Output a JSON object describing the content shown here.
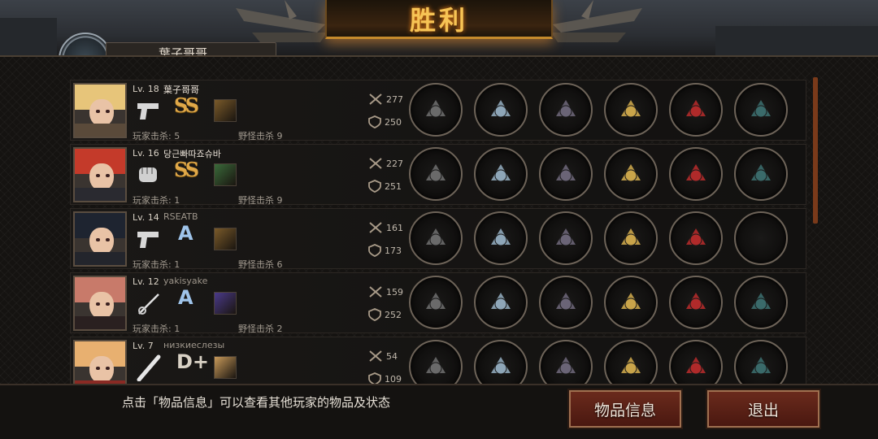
{
  "header": {
    "title": "胜利",
    "top_player_name": "葉子哥哥"
  },
  "players": [
    {
      "level_prefix": "Lv.",
      "level": "18",
      "name": "葉子哥哥",
      "name_dim": false,
      "grade": "SS",
      "grade_kind": "ss",
      "weapon": "pistol-icon",
      "player_kills_label": "玩家击杀:",
      "player_kills": "5",
      "monster_kills_label": "野怪击杀",
      "monster_kills": "9",
      "attack": "277",
      "defense": "250",
      "hair": "#e7c57a",
      "cloth": "#5a4a3a",
      "skill_color": "#7a5a2a",
      "gear": [
        "sniper-rifle-icon",
        "visor-helmet-icon",
        "armor-chest-icon",
        "winged-shield-icon",
        "red-heels-icon",
        "scope-icon"
      ]
    },
    {
      "level_prefix": "Lv.",
      "level": "16",
      "name": "당근빠따죠슈바",
      "name_dim": false,
      "grade": "SS",
      "grade_kind": "ss",
      "weapon": "fist-icon",
      "player_kills_label": "玩家击杀:",
      "player_kills": "1",
      "monster_kills_label": "野怪击杀",
      "monster_kills": "9",
      "attack": "227",
      "defense": "251",
      "hair": "#c43a2a",
      "cloth": "#2a2a30",
      "skill_color": "#3a6a3a",
      "gear": [
        "claw-blades-icon",
        "dark-helmet-icon",
        "armor-chest-icon",
        "laptop-icon",
        "blue-sneakers-icon",
        "mech-armor-icon"
      ]
    },
    {
      "level_prefix": "Lv.",
      "level": "14",
      "name": "RSEATB",
      "name_dim": true,
      "grade": "A",
      "grade_kind": "a",
      "weapon": "pistol-icon",
      "player_kills_label": "玩家击杀:",
      "player_kills": "1",
      "monster_kills_label": "野怪击杀",
      "monster_kills": "6",
      "attack": "161",
      "defense": "173",
      "hair": "#1e2430",
      "cloth": "#23252c",
      "skill_color": "#7a5a2a",
      "gear": [
        "revolver-icon",
        "visor-helmet-icon",
        "scale-armor-icon",
        "arm-guard-icon",
        "green-sneakers-icon",
        "empty-slot-icon"
      ]
    },
    {
      "level_prefix": "Lv.",
      "level": "12",
      "name": "yakisyake",
      "name_dim": true,
      "grade": "A",
      "grade_kind": "a",
      "weapon": "rapier-icon",
      "player_kills_label": "玩家击杀:",
      "player_kills": "1",
      "monster_kills_label": "野怪击杀",
      "monster_kills": "2",
      "attack": "159",
      "defense": "252",
      "hair": "#c87a6a",
      "cloth": "#2a2020",
      "skill_color": "#4a3a8a",
      "gear": [
        "sword-icon",
        "knight-helmet-icon",
        "plate-armor-icon",
        "bracer-icon",
        "steel-boots-icon",
        "galaxy-orb-icon"
      ]
    },
    {
      "level_prefix": "Lv.",
      "level": "7",
      "name": "низкиеслезы",
      "name_dim": true,
      "grade": "D+",
      "grade_kind": "d",
      "weapon": "bat-icon",
      "player_kills_label": "玩家击杀:",
      "player_kills": "",
      "monster_kills_label": "野怪击杀",
      "monster_kills": "",
      "attack": "54",
      "defense": "109",
      "hair": "#e8b070",
      "cloth": "#8a2a24",
      "skill_color": "#c89a5a",
      "gear": [
        "staff-icon",
        "knight-helmet-icon",
        "pink-armor-icon",
        "gauntlet-icon",
        "steel-boots-icon",
        "baton-icon"
      ]
    }
  ],
  "footer": {
    "hint": "点击「物品信息」可以查看其他玩家的物品及状态",
    "info_button": "物品信息",
    "exit_button": "退出"
  },
  "colors": {
    "accent_gold": "#f7c455",
    "button_red": "#6a2a1c"
  }
}
